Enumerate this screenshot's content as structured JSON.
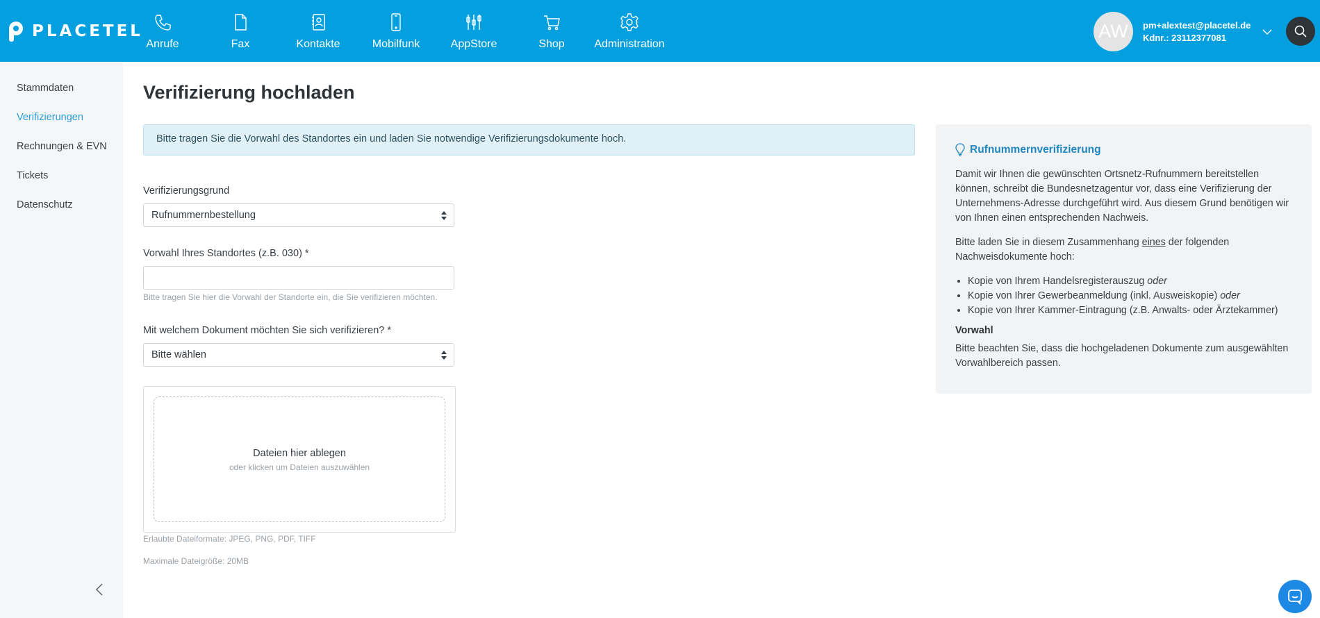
{
  "brand": {
    "name": "PLACETEL",
    "header_color": "#049fde"
  },
  "nav": [
    {
      "label": "Anrufe",
      "icon": "phone-icon"
    },
    {
      "label": "Fax",
      "icon": "document-icon"
    },
    {
      "label": "Kontakte",
      "icon": "contacts-icon"
    },
    {
      "label": "Mobilfunk",
      "icon": "mobile-icon"
    },
    {
      "label": "AppStore",
      "icon": "appstore-icon"
    },
    {
      "label": "Shop",
      "icon": "cart-icon"
    },
    {
      "label": "Administration",
      "icon": "gear-icon"
    }
  ],
  "user": {
    "initials": "AW",
    "email": "pm+alextest@placetel.de",
    "customer_no": "Kdnr.: 23112377081"
  },
  "sidebar": {
    "items": [
      {
        "label": "Stammdaten",
        "active": false
      },
      {
        "label": "Verifizierungen",
        "active": true
      },
      {
        "label": "Rechnungen & EVN",
        "active": false
      },
      {
        "label": "Tickets",
        "active": false
      },
      {
        "label": "Datenschutz",
        "active": false
      }
    ]
  },
  "main": {
    "title": "Verifizierung hochladen",
    "alert": "Bitte tragen Sie die Vorwahl des Standortes ein und laden Sie notwendige Verifizierungsdokumente hoch.",
    "reason": {
      "label": "Verifizierungsgrund",
      "value": "Rufnummernbestellung"
    },
    "area_code": {
      "label": "Vorwahl Ihres Standortes (z.B. 030) *",
      "value": "",
      "hint": "Bitte tragen Sie hier die Vorwahl der Standorte ein, die Sie verifizieren möchten."
    },
    "document": {
      "label": "Mit welchem Dokument möchten Sie sich verifizieren? *",
      "value": "Bitte wählen"
    },
    "dropzone": {
      "title": "Dateien hier ablegen",
      "subtitle": "oder klicken um Dateien auszuwählen"
    },
    "allowed_formats": "Erlaubte Dateiformate: JPEG, PNG, PDF, TIFF",
    "max_size": "Maximale Dateigröße: 20MB"
  },
  "info": {
    "title": "Rufnummernverifizierung",
    "p1": "Damit wir Ihnen die gewünschten Ortsnetz-Rufnummern bereitstellen können, schreibt die Bundesnetzagentur vor, dass eine Verifizierung der Unternehmens-Adresse durchgeführt wird. Aus diesem Grund benötigen wir von Ihnen einen entsprechenden Nachweis.",
    "p2_before": "Bitte laden Sie in diesem Zusammenhang ",
    "p2_em": "eines",
    "p2_after": " der folgenden Nachweisdokumente hoch:",
    "list": [
      {
        "text": "Kopie von Ihrem Handelsregisterauszug ",
        "suffix": "oder"
      },
      {
        "text": "Kopie von Ihrer Gewerbeanmeldung (inkl. Ausweiskopie) ",
        "suffix": "oder"
      },
      {
        "text": "Kopie von Ihrer Kammer-Eintragung (z.B. Anwalts- oder Ärztekammer)",
        "suffix": ""
      }
    ],
    "subtitle": "Vorwahl",
    "p3": "Bitte beachten Sie, dass die hochgeladenen Dokumente zum ausgewählten Vorwahlbereich passen."
  }
}
